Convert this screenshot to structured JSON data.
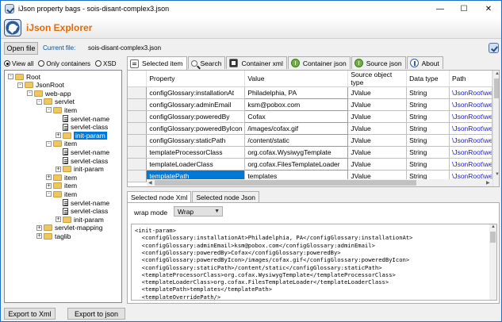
{
  "window": {
    "title": "iJson property bags - sois-disant-complex3.json",
    "minimize": "—",
    "maximize": "☐",
    "close": "✕"
  },
  "banner": {
    "title": "iJson Explorer"
  },
  "toolbar": {
    "open_file": "Open file",
    "current_file_label": "Current file:",
    "current_file_value": "sois-disant-complex3.json"
  },
  "filter": {
    "options": [
      "View all",
      "Only containers",
      "XSD"
    ],
    "selected": "View all"
  },
  "tree": [
    {
      "label": "Root",
      "indent": 0,
      "icon": "folder",
      "expander": "-"
    },
    {
      "label": "JsonRoot",
      "indent": 1,
      "icon": "folder",
      "expander": "-"
    },
    {
      "label": "web-app",
      "indent": 2,
      "icon": "folder",
      "expander": "-"
    },
    {
      "label": "servlet",
      "indent": 3,
      "icon": "folder",
      "expander": "-"
    },
    {
      "label": "item",
      "indent": 4,
      "icon": "folder",
      "expander": "-"
    },
    {
      "label": "servlet-name",
      "indent": 5,
      "icon": "doc",
      "expander": ""
    },
    {
      "label": "servlet-class",
      "indent": 5,
      "icon": "doc",
      "expander": ""
    },
    {
      "label": "init-param",
      "indent": 5,
      "icon": "folder",
      "expander": "+",
      "selected": true
    },
    {
      "label": "item",
      "indent": 4,
      "icon": "folder",
      "expander": "-"
    },
    {
      "label": "servlet-name",
      "indent": 5,
      "icon": "doc",
      "expander": ""
    },
    {
      "label": "servlet-class",
      "indent": 5,
      "icon": "doc",
      "expander": ""
    },
    {
      "label": "init-param",
      "indent": 5,
      "icon": "folder",
      "expander": "+"
    },
    {
      "label": "item",
      "indent": 4,
      "icon": "folder",
      "expander": "+"
    },
    {
      "label": "item",
      "indent": 4,
      "icon": "folder",
      "expander": "+"
    },
    {
      "label": "item",
      "indent": 4,
      "icon": "folder",
      "expander": "-"
    },
    {
      "label": "servlet-name",
      "indent": 5,
      "icon": "doc",
      "expander": ""
    },
    {
      "label": "servlet-class",
      "indent": 5,
      "icon": "doc",
      "expander": ""
    },
    {
      "label": "init-param",
      "indent": 5,
      "icon": "folder",
      "expander": "+"
    },
    {
      "label": "servlet-mapping",
      "indent": 3,
      "icon": "folder",
      "expander": "+"
    },
    {
      "label": "taglib",
      "indent": 3,
      "icon": "folder",
      "expander": "+"
    }
  ],
  "footer": {
    "export_xml": "Export to Xml",
    "export_json": "Export to json"
  },
  "tabs": [
    {
      "label": "Selected item",
      "icon": "doc-icon",
      "active": true
    },
    {
      "label": "Search",
      "icon": "search-icon"
    },
    {
      "label": "Container xml",
      "icon": "xml-icon"
    },
    {
      "label": "Container json",
      "icon": "json-icon"
    },
    {
      "label": "Source json",
      "icon": "json-icon"
    },
    {
      "label": "About",
      "icon": "info-icon"
    }
  ],
  "grid": {
    "columns": [
      "Property",
      "Value",
      "Source object type",
      "Data type",
      "Path"
    ],
    "rows": [
      [
        "configGlossary:installationAt",
        "Philadelphia, PA",
        "JValue",
        "String",
        "\\JsonRoot\\web"
      ],
      [
        "configGlossary:adminEmail",
        "ksm@pobox.com",
        "JValue",
        "String",
        "\\JsonRoot\\web"
      ],
      [
        "configGlossary:poweredBy",
        "Cofax",
        "JValue",
        "String",
        "\\JsonRoot\\web"
      ],
      [
        "configGlossary:poweredByIcon",
        "/images/cofax.gif",
        "JValue",
        "String",
        "\\JsonRoot\\web"
      ],
      [
        "configGlossary:staticPath",
        "/content/static",
        "JValue",
        "String",
        "\\JsonRoot\\web"
      ],
      [
        "templateProcessorClass",
        "org.cofax.WysiwygTemplate",
        "JValue",
        "String",
        "\\JsonRoot\\web"
      ],
      [
        "templateLoaderClass",
        "org.cofax.FilesTemplateLoader",
        "JValue",
        "String",
        "\\JsonRoot\\web"
      ],
      [
        "templatePath",
        "templates",
        "JValue",
        "String",
        "\\JsonRoot\\web"
      ]
    ],
    "selected_row": 7
  },
  "subtabs": [
    {
      "label": "Selected node Xml",
      "active": true
    },
    {
      "label": "Selected node Json"
    }
  ],
  "xml_panel": {
    "wrap_label": "wrap mode",
    "wrap_value": "Wrap",
    "lines": [
      "<init-param>",
      "  <configGlossary:installationAt>Philadelphia, PA</configGlossary:installationAt>",
      "  <configGlossary:adminEmail>ksm@pobox.com</configGlossary:adminEmail>",
      "  <configGlossary:poweredBy>Cofax</configGlossary:poweredBy>",
      "  <configGlossary:poweredByIcon>/images/cofax.gif</configGlossary:poweredByIcon>",
      "  <configGlossary:staticPath>/content/static</configGlossary:staticPath>",
      "  <templateProcessorClass>org.cofax.WysiwygTemplate</templateProcessorClass>",
      "  <templateLoaderClass>org.cofax.FilesTemplateLoader</templateLoaderClass>",
      "  <templatePath>templates</templatePath>",
      "  <templateOverridePath/>"
    ]
  }
}
